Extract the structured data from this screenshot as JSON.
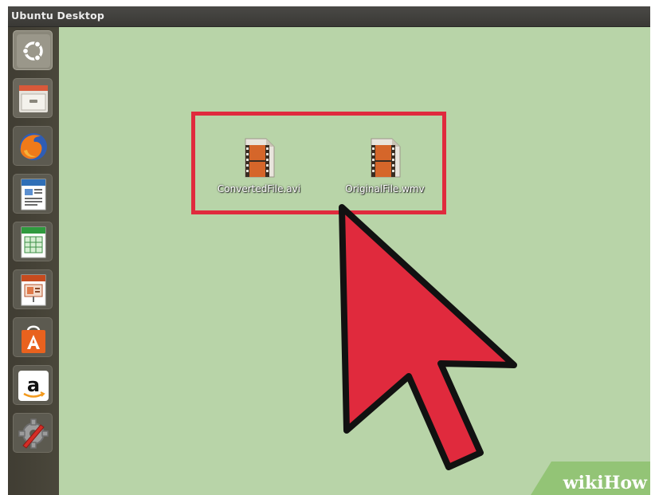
{
  "topbar": {
    "title": "Ubuntu Desktop"
  },
  "launcher": {
    "items": [
      {
        "name": "ubuntu-dash",
        "icon": "ubuntu-logo-icon"
      },
      {
        "name": "files",
        "icon": "file-cabinet-icon"
      },
      {
        "name": "firefox",
        "icon": "firefox-icon"
      },
      {
        "name": "libreoffice-writer",
        "icon": "writer-document-icon"
      },
      {
        "name": "libreoffice-calc",
        "icon": "calc-spreadsheet-icon"
      },
      {
        "name": "libreoffice-impress",
        "icon": "impress-presentation-icon"
      },
      {
        "name": "ubuntu-software-center",
        "icon": "shopping-bag-icon"
      },
      {
        "name": "amazon",
        "icon": "amazon-icon"
      },
      {
        "name": "system-settings",
        "icon": "settings-gear-icon"
      }
    ]
  },
  "desktop": {
    "files": [
      {
        "label": "ConvertedFile.avi",
        "icon": "video-file-icon"
      },
      {
        "label": "OriginalFile.wmv",
        "icon": "video-file-icon"
      }
    ]
  },
  "watermark": {
    "wiki": "wiki",
    "how": "How"
  },
  "colors": {
    "desktop": "#b8d4a8",
    "highlight": "#e02a3d",
    "cursor": "#e02a3d"
  }
}
